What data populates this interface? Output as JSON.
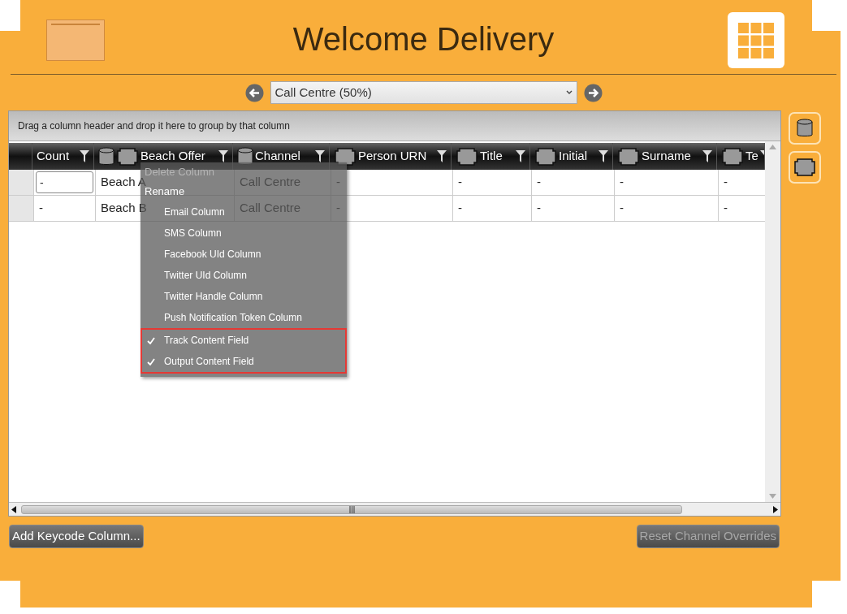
{
  "title": "Welcome Delivery",
  "channel_select": {
    "value": "Call Centre (50%)"
  },
  "group_panel": {
    "hint": "Drag a column header and drop it here to group by that column"
  },
  "table": {
    "columns": [
      {
        "label": "Count",
        "database": false,
        "field": false
      },
      {
        "label": "Beach Offer",
        "database": true,
        "field": true
      },
      {
        "label": "Channel",
        "database": true,
        "field": false
      },
      {
        "label": "Person URN",
        "database": false,
        "field": true
      },
      {
        "label": "Title",
        "database": false,
        "field": true
      },
      {
        "label": "Initial",
        "database": false,
        "field": true
      },
      {
        "label": "Surname",
        "database": false,
        "field": true
      },
      {
        "label": "Te",
        "database": false,
        "field": true
      }
    ],
    "rows": [
      {
        "cells": [
          "-",
          "Beach A",
          "Call Centre",
          "-",
          "-",
          "-",
          "-",
          "-"
        ],
        "editing": true
      },
      {
        "cells": [
          "-",
          "Beach B",
          "Call Centre",
          "-",
          "-",
          "-",
          "-",
          "-"
        ],
        "editing": false
      }
    ]
  },
  "context_menu": {
    "items": [
      {
        "kind": "action",
        "label": "Delete Column",
        "disabled": true
      },
      {
        "kind": "action",
        "label": "Rename",
        "disabled": false
      },
      {
        "kind": "option",
        "label": "Email Column",
        "checked": false
      },
      {
        "kind": "option",
        "label": "SMS Column",
        "checked": false
      },
      {
        "kind": "option",
        "label": "Facebook UId Column",
        "checked": false
      },
      {
        "kind": "option",
        "label": "Twitter UId Column",
        "checked": false
      },
      {
        "kind": "option",
        "label": "Twitter Handle Column",
        "checked": false
      },
      {
        "kind": "option",
        "label": "Push Notification Token Column",
        "checked": false
      },
      {
        "kind": "option",
        "label": "Track Content Field",
        "checked": true
      },
      {
        "kind": "option",
        "label": "Output Content Field",
        "checked": true
      }
    ]
  },
  "buttons": [
    {
      "label": "Add Keycode Column...",
      "disabled": false
    },
    {
      "label": "Reset Channel Overrides",
      "disabled": true
    }
  ]
}
